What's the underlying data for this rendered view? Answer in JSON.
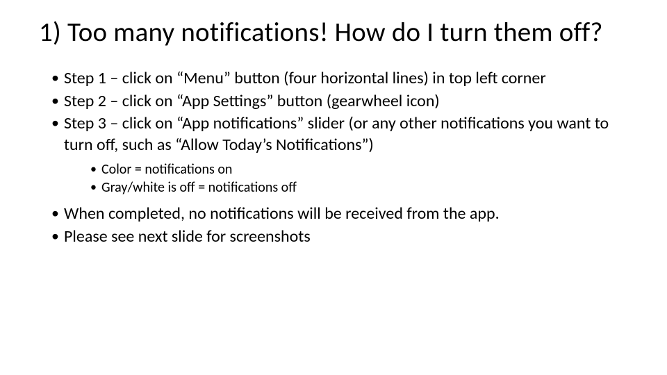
{
  "title": "1) Too many notifications! How do I turn them off?",
  "bullets": {
    "b1": "Step 1 – click on “Menu” button (four horizontal lines) in top left corner",
    "b2": "Step 2 – click on “App Settings” button (gearwheel icon)",
    "b3": "Step 3 – click on “App notifications” slider (or any other notifications you want to turn off, such as “Allow Today’s Notifications”)",
    "b3_sub": {
      "s1": "Color = notifications on",
      "s2": "Gray/white is off = notifications off"
    },
    "b4": "When completed, no notifications will be received from the app.",
    "b5": "Please see next slide for screenshots"
  }
}
